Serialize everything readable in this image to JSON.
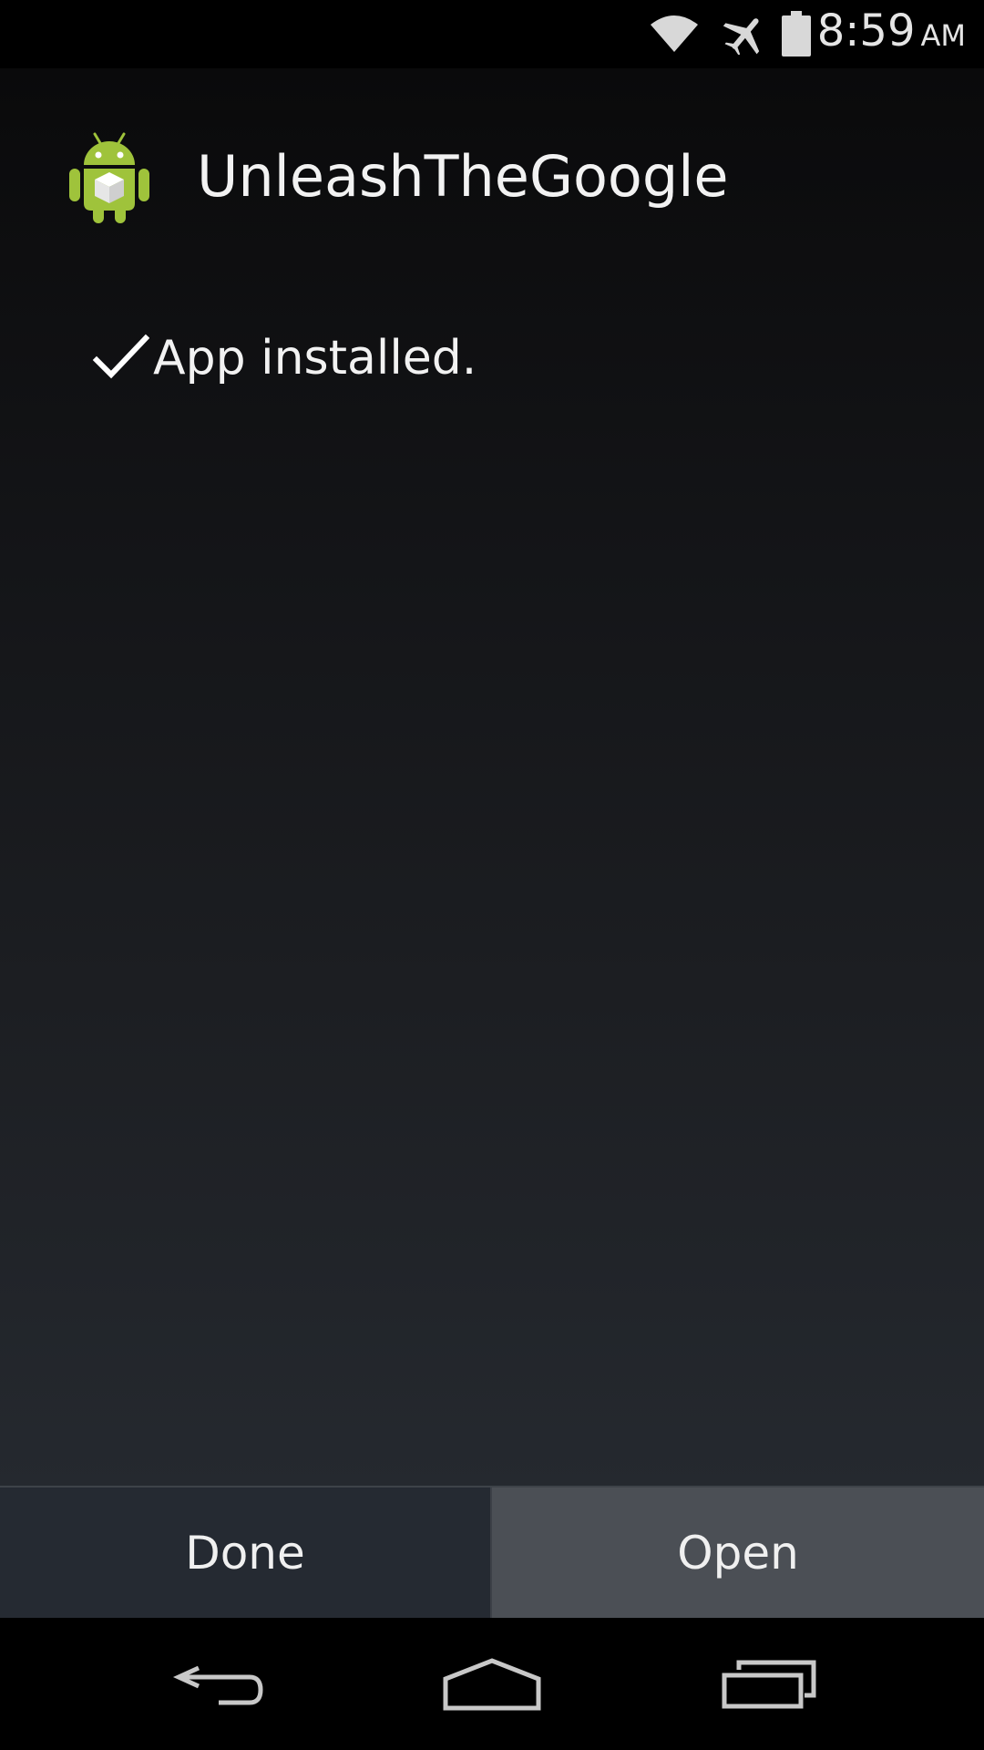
{
  "status_bar": {
    "time": "8:59",
    "ampm": "AM",
    "icons": [
      "wifi-icon",
      "airplane-mode-icon",
      "battery-icon"
    ]
  },
  "app": {
    "name": "UnleashTheGoogle",
    "icon": "android-package-icon",
    "status_icon": "check-icon",
    "status_message": "App installed."
  },
  "buttons": {
    "done_label": "Done",
    "open_label": "Open"
  },
  "nav_bar": {
    "icons": [
      "back-icon",
      "home-icon",
      "recents-icon"
    ]
  },
  "colors": {
    "android_green": "#9fc33b",
    "text_primary": "#f2f2f2",
    "done_bg": "#252a32",
    "open_bg": "#4b4f55"
  }
}
